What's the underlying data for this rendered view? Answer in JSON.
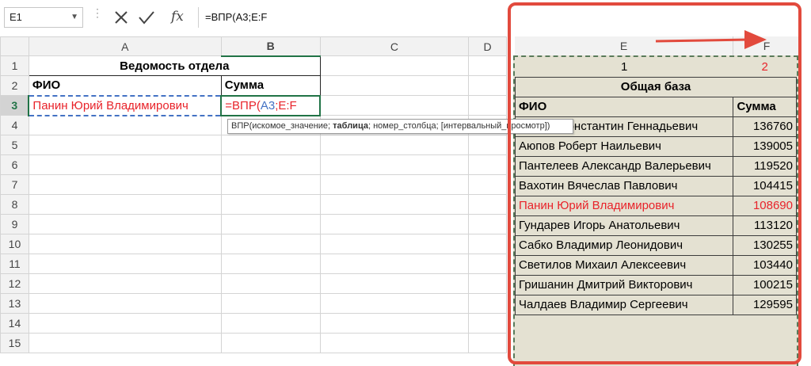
{
  "name_box": "E1",
  "formula_bar": {
    "value": "=ВПР(A3;E:F",
    "fx_label": "fx"
  },
  "columns": [
    "A",
    "B",
    "C",
    "D",
    "E",
    "F"
  ],
  "rows": [
    "1",
    "2",
    "3",
    "4",
    "5",
    "6",
    "7",
    "8",
    "9",
    "10",
    "11",
    "12",
    "13",
    "14",
    "15"
  ],
  "sheet": {
    "title": "Ведомость отдела",
    "header_name": "ФИО",
    "header_sum": "Сумма",
    "row3_name": "Панин Юрий Владимирович",
    "row3_formula_prefix": "=ВПР(",
    "row3_formula_ref1": "A3",
    "row3_formula_sep": ";",
    "row3_formula_ref2": "E:F"
  },
  "tooltip": {
    "fn": "ВПР(",
    "arg1": "искомое_значение",
    "sep1": "; ",
    "arg2": "таблица",
    "sep2": "; ",
    "arg3": "номер_столбца",
    "sep3": "; ",
    "arg4": "[интервальный_просмотр]",
    "end": ")"
  },
  "database": {
    "index_e": "1",
    "index_f": "2",
    "title": "Общая база",
    "header_name": "ФИО",
    "header_sum": "Сумма",
    "rows": [
      {
        "name": "Брагин Константин Геннадьевич",
        "sum": "136760"
      },
      {
        "name": "Аюпов Роберт Наильевич",
        "sum": "139005"
      },
      {
        "name": "Пантелеев Александр Валерьевич",
        "sum": "119520"
      },
      {
        "name": "Вахотин Вячеслав Павлович",
        "sum": "104415"
      },
      {
        "name": "Панин Юрий Владимирович",
        "sum": "108690"
      },
      {
        "name": "Гундарев Игорь Анатольевич",
        "sum": "113120"
      },
      {
        "name": "Сабко Владимир Леонидович",
        "sum": "130255"
      },
      {
        "name": "Светилов Михаил Алексеевич",
        "sum": "103440"
      },
      {
        "name": "Гришанин Дмитрий Викторович",
        "sum": "100215"
      },
      {
        "name": "Чалдаев Владимир Сергеевич",
        "sum": "129595"
      }
    ]
  },
  "colors": {
    "accent_red": "#e24a3d",
    "excel_green": "#217346",
    "db_fill": "#e4e1d2",
    "ref_blue": "#4472c4",
    "ref_red": "#e8232a"
  }
}
